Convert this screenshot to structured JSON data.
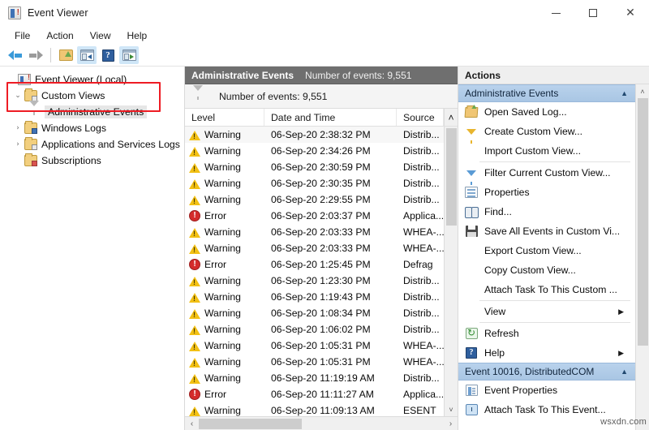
{
  "window": {
    "title": "Event Viewer",
    "app_icon": "event-viewer-icon",
    "minimize_label": "–",
    "maximize_label": "□",
    "close_label": "✕"
  },
  "menubar": {
    "items": [
      {
        "label": "File"
      },
      {
        "label": "Action"
      },
      {
        "label": "View"
      },
      {
        "label": "Help"
      }
    ]
  },
  "toolbar": {
    "buttons": [
      {
        "name": "back-button",
        "icon": "arrow-left-icon"
      },
      {
        "name": "forward-button",
        "icon": "arrow-right-icon"
      },
      {
        "name": "open-saved-log-button",
        "icon": "folder-open-icon"
      },
      {
        "name": "show-hide-console-tree-button",
        "icon": "console-tree-icon"
      },
      {
        "name": "help-button",
        "icon": "help-question-icon"
      },
      {
        "name": "show-hide-action-pane-button",
        "icon": "action-pane-icon"
      }
    ]
  },
  "tree": {
    "nodes": [
      {
        "label": "Event Viewer (Local)",
        "icon": "event-viewer-icon",
        "twisty": "",
        "indent": 0,
        "selected": false
      },
      {
        "label": "Custom Views",
        "icon": "folder-custom-views-icon",
        "twisty": "⌄",
        "indent": 1,
        "selected": false
      },
      {
        "label": "Administrative Events",
        "icon": "funnel-gray-icon",
        "twisty": "",
        "indent": 2,
        "selected": true
      },
      {
        "label": "Windows Logs",
        "icon": "folder-windows-logs-icon",
        "twisty": "›",
        "indent": 1,
        "selected": false
      },
      {
        "label": "Applications and Services Logs",
        "icon": "folder-app-services-icon",
        "twisty": "›",
        "indent": 1,
        "selected": false
      },
      {
        "label": "Subscriptions",
        "icon": "folder-subscriptions-icon",
        "twisty": "",
        "indent": 1,
        "selected": false
      }
    ]
  },
  "center": {
    "header_title": "Administrative Events",
    "header_subtitle": "Number of events: 9,551",
    "filter_label": "Number of events: 9,551",
    "filter_icon": "funnel-icon",
    "columns": [
      {
        "label": "Level"
      },
      {
        "label": "Date and Time"
      },
      {
        "label": "Source"
      }
    ],
    "scroll_up_glyph": "˄",
    "scroll_down_glyph": "˅",
    "hscroll_left_glyph": "‹",
    "hscroll_right_glyph": "›",
    "rows": [
      {
        "level": "Warning",
        "severity": "warning",
        "datetime": "06-Sep-20 2:38:32 PM",
        "source": "Distrib..."
      },
      {
        "level": "Warning",
        "severity": "warning",
        "datetime": "06-Sep-20 2:34:26 PM",
        "source": "Distrib..."
      },
      {
        "level": "Warning",
        "severity": "warning",
        "datetime": "06-Sep-20 2:30:59 PM",
        "source": "Distrib..."
      },
      {
        "level": "Warning",
        "severity": "warning",
        "datetime": "06-Sep-20 2:30:35 PM",
        "source": "Distrib..."
      },
      {
        "level": "Warning",
        "severity": "warning",
        "datetime": "06-Sep-20 2:29:55 PM",
        "source": "Distrib..."
      },
      {
        "level": "Error",
        "severity": "error",
        "datetime": "06-Sep-20 2:03:37 PM",
        "source": "Applica..."
      },
      {
        "level": "Warning",
        "severity": "warning",
        "datetime": "06-Sep-20 2:03:33 PM",
        "source": "WHEA-..."
      },
      {
        "level": "Warning",
        "severity": "warning",
        "datetime": "06-Sep-20 2:03:33 PM",
        "source": "WHEA-..."
      },
      {
        "level": "Error",
        "severity": "error",
        "datetime": "06-Sep-20 1:25:45 PM",
        "source": "Defrag"
      },
      {
        "level": "Warning",
        "severity": "warning",
        "datetime": "06-Sep-20 1:23:30 PM",
        "source": "Distrib..."
      },
      {
        "level": "Warning",
        "severity": "warning",
        "datetime": "06-Sep-20 1:19:43 PM",
        "source": "Distrib..."
      },
      {
        "level": "Warning",
        "severity": "warning",
        "datetime": "06-Sep-20 1:08:34 PM",
        "source": "Distrib..."
      },
      {
        "level": "Warning",
        "severity": "warning",
        "datetime": "06-Sep-20 1:06:02 PM",
        "source": "Distrib..."
      },
      {
        "level": "Warning",
        "severity": "warning",
        "datetime": "06-Sep-20 1:05:31 PM",
        "source": "WHEA-..."
      },
      {
        "level": "Warning",
        "severity": "warning",
        "datetime": "06-Sep-20 1:05:31 PM",
        "source": "WHEA-..."
      },
      {
        "level": "Warning",
        "severity": "warning",
        "datetime": "06-Sep-20 11:19:19 AM",
        "source": "Distrib..."
      },
      {
        "level": "Error",
        "severity": "error",
        "datetime": "06-Sep-20 11:11:27 AM",
        "source": "Applica..."
      },
      {
        "level": "Warning",
        "severity": "warning",
        "datetime": "06-Sep-20 11:09:13 AM",
        "source": "ESENT"
      }
    ]
  },
  "actions": {
    "header": "Actions",
    "group1": {
      "title": "Administrative Events",
      "collapse_glyph": "▲",
      "items": [
        {
          "label": "Open Saved Log...",
          "icon": "folder-open-icon",
          "submenu": false,
          "sep_after": false
        },
        {
          "label": "Create Custom View...",
          "icon": "funnel-yellow-icon",
          "submenu": false,
          "sep_after": false
        },
        {
          "label": "Import Custom View...",
          "icon": "none",
          "submenu": false,
          "sep_after": true
        },
        {
          "label": "Filter Current Custom View...",
          "icon": "funnel-blue-icon",
          "submenu": false,
          "sep_after": false
        },
        {
          "label": "Properties",
          "icon": "properties-icon",
          "submenu": false,
          "sep_after": false
        },
        {
          "label": "Find...",
          "icon": "binoculars-icon",
          "submenu": false,
          "sep_after": false
        },
        {
          "label": "Save All Events in Custom Vi...",
          "icon": "save-disk-icon",
          "submenu": false,
          "sep_after": false
        },
        {
          "label": "Export Custom View...",
          "icon": "none",
          "submenu": false,
          "sep_after": false
        },
        {
          "label": "Copy Custom View...",
          "icon": "none",
          "submenu": false,
          "sep_after": false
        },
        {
          "label": "Attach Task To This Custom ...",
          "icon": "none",
          "submenu": false,
          "sep_after": true
        },
        {
          "label": "View",
          "icon": "none",
          "submenu": true,
          "sep_after": true
        },
        {
          "label": "Refresh",
          "icon": "refresh-icon",
          "submenu": false,
          "sep_after": false
        },
        {
          "label": "Help",
          "icon": "help-question-icon",
          "submenu": true,
          "sep_after": false
        }
      ]
    },
    "group2": {
      "title": "Event 10016, DistributedCOM",
      "collapse_glyph": "▲",
      "items": [
        {
          "label": "Event Properties",
          "icon": "event-properties-icon",
          "submenu": false,
          "sep_after": false
        },
        {
          "label": "Attach Task To This Event...",
          "icon": "clock-task-icon",
          "submenu": false,
          "sep_after": false
        }
      ]
    },
    "scroll_up_glyph": "˄"
  },
  "annotation": {
    "highlight_color": "#ee1c24"
  },
  "watermark": {
    "text": "wsxdn.com"
  }
}
